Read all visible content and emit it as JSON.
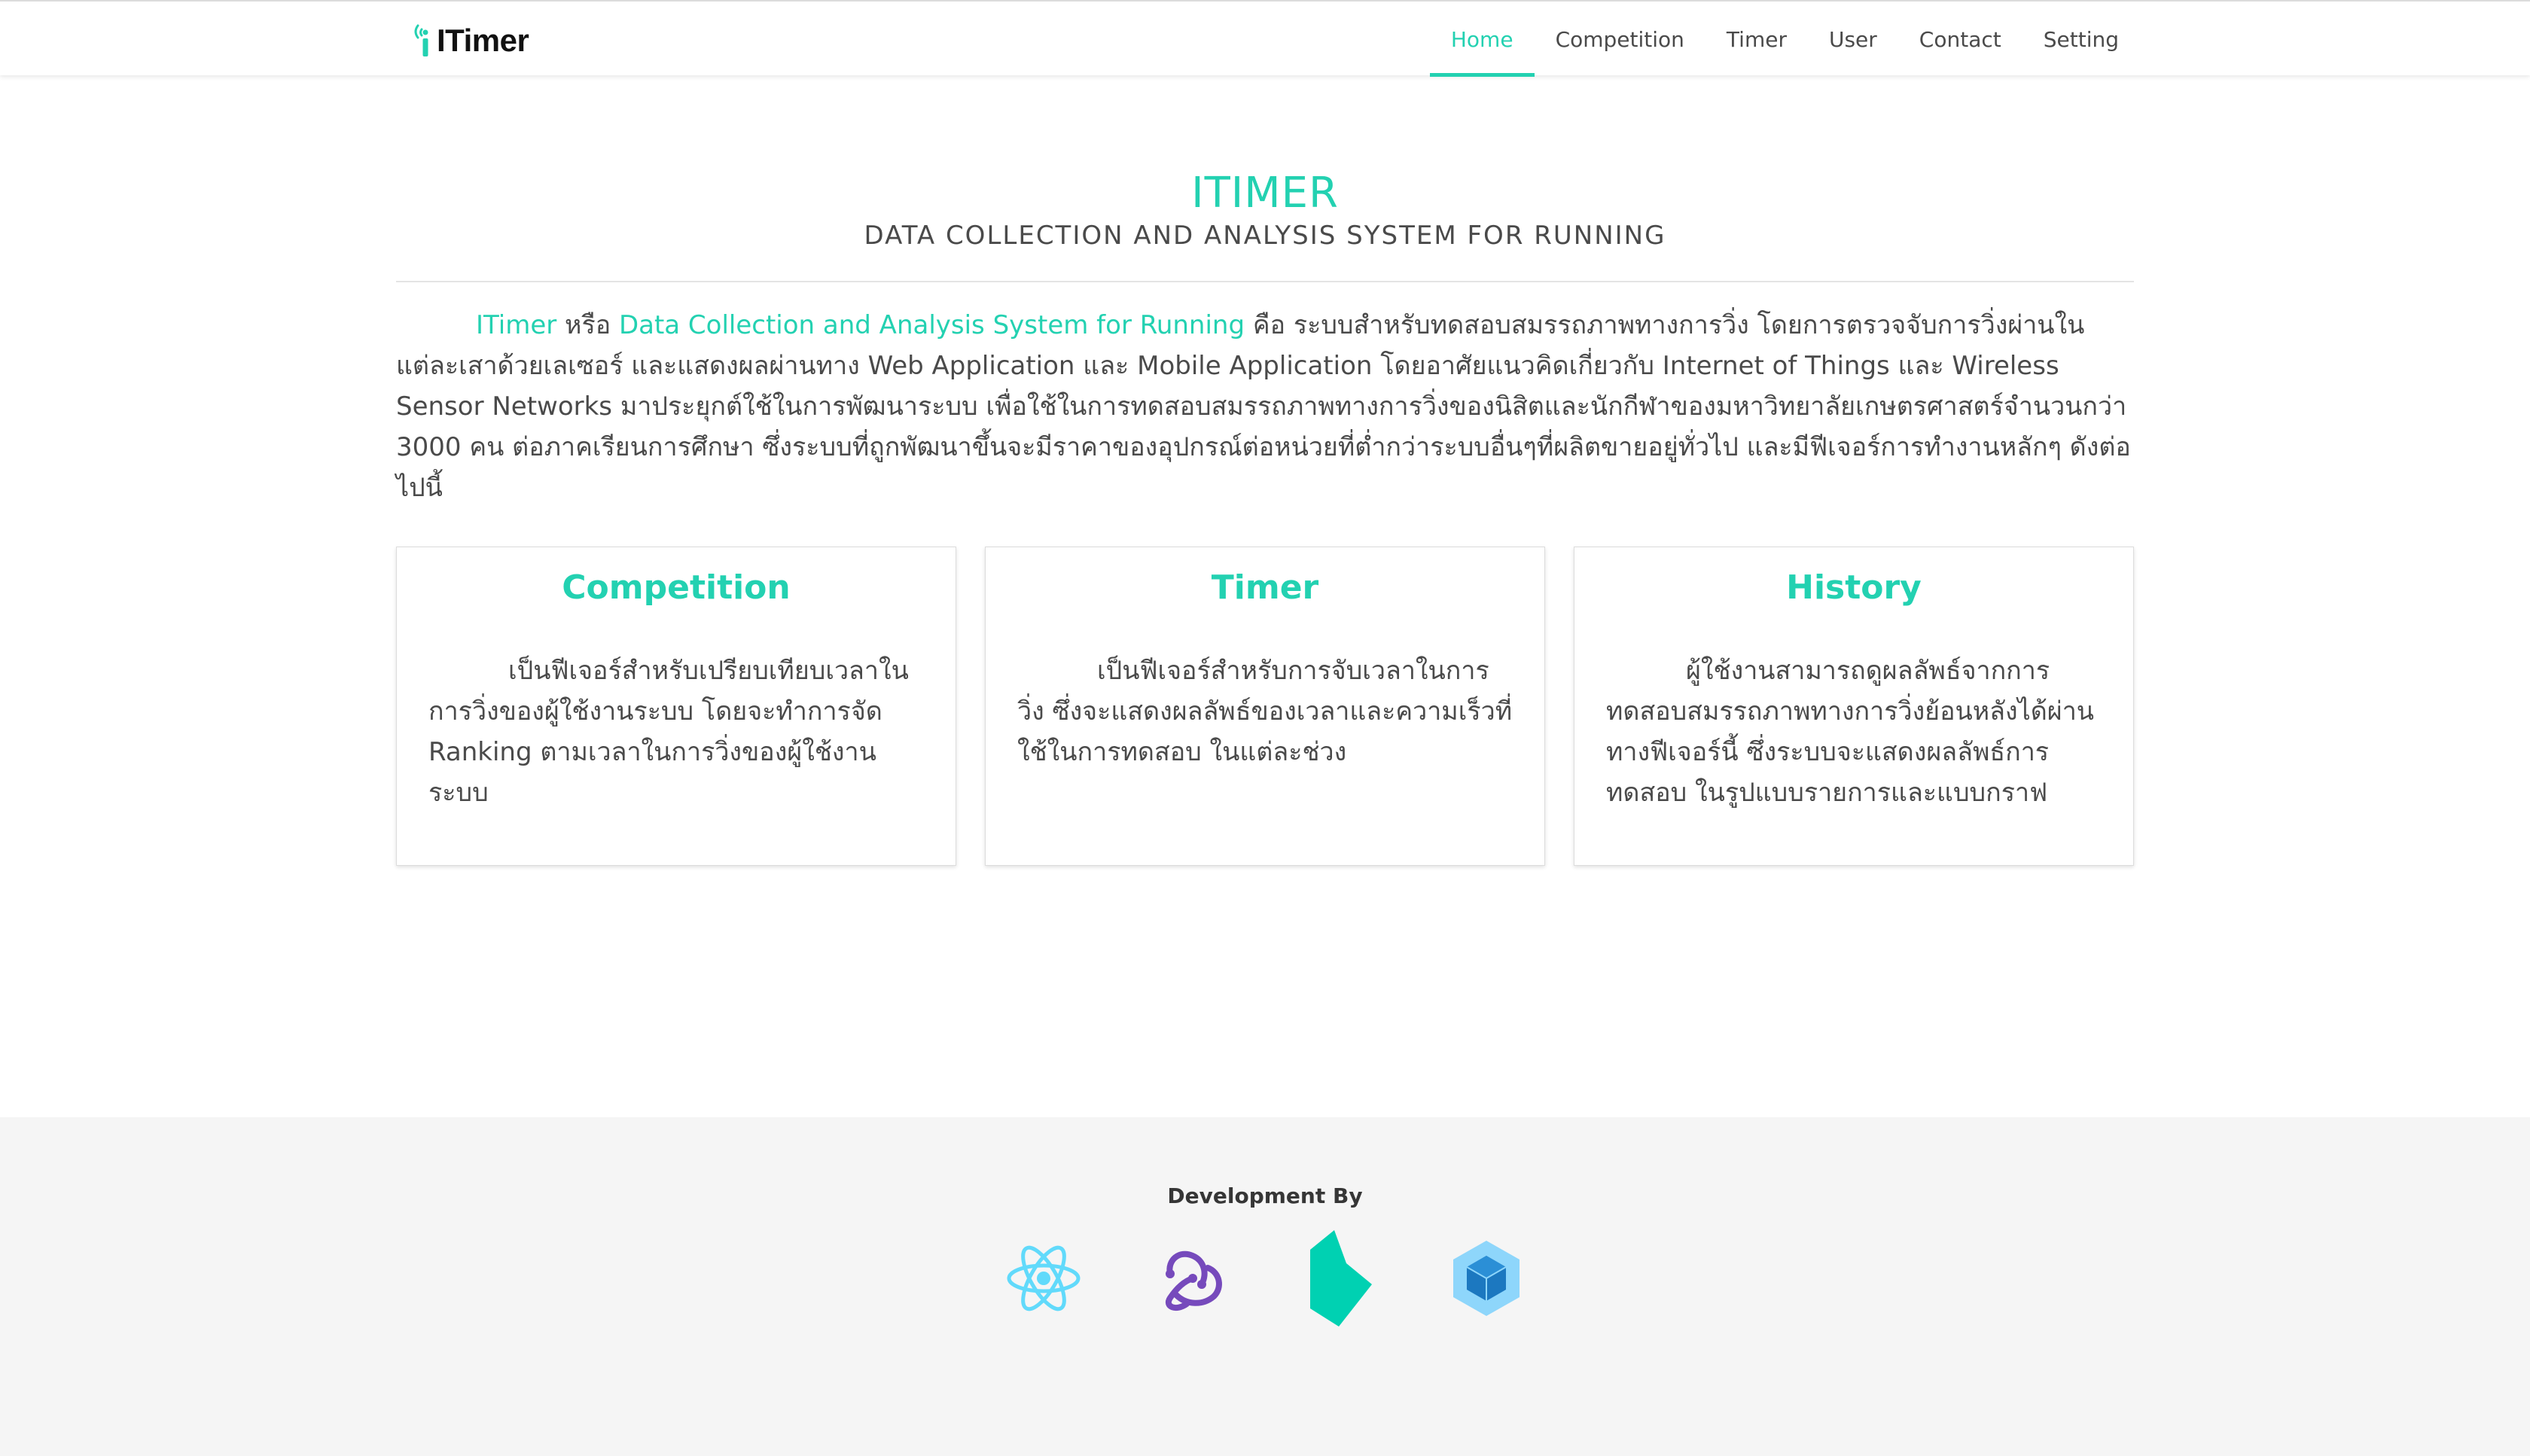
{
  "brand": {
    "name": "ITimer",
    "icon": "itimer-signal-logo"
  },
  "nav": {
    "items": [
      {
        "label": "Home",
        "active": true
      },
      {
        "label": "Competition",
        "active": false
      },
      {
        "label": "Timer",
        "active": false
      },
      {
        "label": "User",
        "active": false
      },
      {
        "label": "Contact",
        "active": false
      },
      {
        "label": "Setting",
        "active": false
      }
    ]
  },
  "hero": {
    "title": "ITIMER",
    "subtitle": "DATA COLLECTION AND ANALYSIS SYSTEM FOR RUNNING"
  },
  "intro": {
    "highlight1": "ITimer",
    "text1": " หรือ ",
    "highlight2": "Data Collection and Analysis System for Running",
    "text2": " คือ ระบบสำหรับทดสอบสมรรถภาพทางการวิ่ง โดยการตรวจจับการวิ่งผ่านในแต่ละเสาด้วยเลเซอร์ และแสดงผลผ่านทาง Web Application และ Mobile Application โดยอาศัยแนวคิดเกี่ยวกับ Internet of Things และ Wireless Sensor Networks มาประยุกต์ใช้ในการพัฒนาระบบ เพื่อใช้ในการทดสอบสมรรถภาพทางการวิ่งของนิสิตและนักกีฬาของมหาวิทยาลัยเกษตรศาสตร์จำนวนกว่า 3000 คน ต่อภาคเรียนการศึกษา ซึ่งระบบที่ถูกพัฒนาขึ้นจะมีราคาของอุปกรณ์ต่อหน่วยที่ต่ำกว่าระบบอื่นๆที่ผลิตขายอยู่ทั่วไป และมีฟีเจอร์การทำงานหลักๆ ดังต่อไปนี้"
  },
  "cards": [
    {
      "title": "Competition",
      "text": "เป็นฟีเจอร์สำหรับเปรียบเทียบเวลาในการวิ่งของผู้ใช้งานระบบ โดยจะทำการจัด Ranking ตามเวลาในการวิ่งของผู้ใช้งานระบบ"
    },
    {
      "title": "Timer",
      "text": "เป็นฟีเจอร์สำหรับการจับเวลาในการวิ่ง ซึ่งจะแสดงผลลัพธ์ของเวลาและความเร็วที่ใช้ในการทดสอบ ในแต่ละช่วง"
    },
    {
      "title": "History",
      "text": "ผู้ใช้งานสามารถดูผลลัพธ์จากการทดสอบสมรรถภาพทางการวิ่งย้อนหลังได้ผ่านทางฟีเจอร์นี้ ซึ่งระบบจะแสดงผลลัพธ์การทดสอบ ในรูปแบบรายการและแบบกราฟ"
    }
  ],
  "footer": {
    "title": "Development By",
    "logos": [
      "react-icon",
      "redux-icon",
      "bulma-icon",
      "webpack-icon"
    ]
  },
  "colors": {
    "accent": "#23d1b1",
    "text": "#4a4a4a",
    "footer_bg": "#f5f5f5",
    "react": "#61dafb",
    "redux": "#764abc",
    "bulma": "#00d1b2",
    "webpack": "#8ed6fb"
  }
}
